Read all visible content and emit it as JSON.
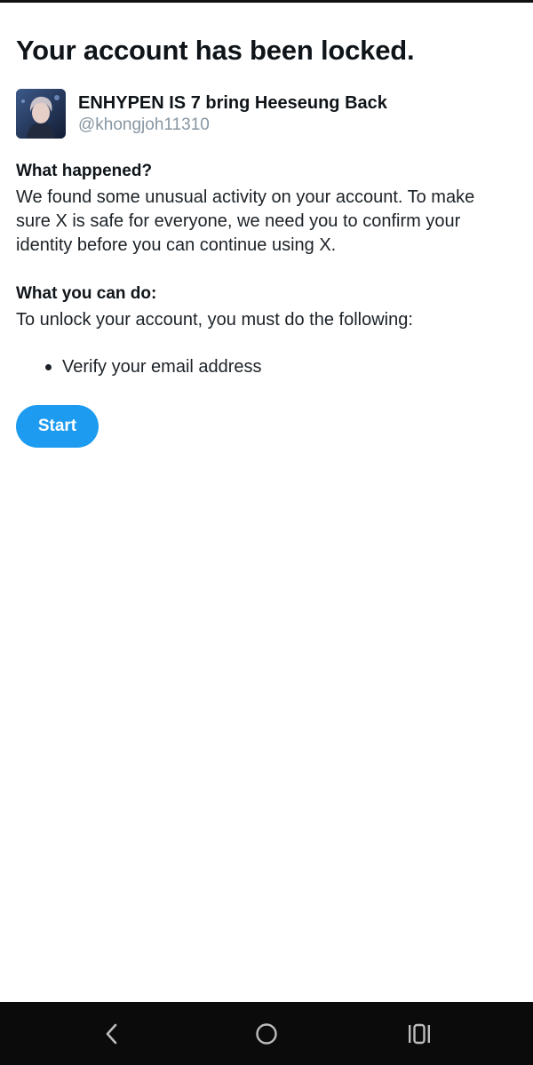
{
  "page": {
    "title": "Your account has been locked."
  },
  "profile": {
    "display_name": "ENHYPEN IS 7 bring Heeseung Back",
    "handle": "@khongjoh11310",
    "avatar_icon": "user-photo"
  },
  "what_happened": {
    "heading": "What happened?",
    "body": "We found some unusual activity on your account. To make sure X is safe for everyone, we need you to confirm your identity before you can continue using X."
  },
  "what_you_can_do": {
    "heading": "What you can do:",
    "body": "To unlock your account, you must do the following:",
    "items": [
      {
        "label": "Verify your email address"
      }
    ]
  },
  "actions": {
    "start_label": "Start"
  },
  "nav_bar": {
    "back_icon": "back-chevron-icon",
    "home_icon": "home-circle-icon",
    "recents_icon": "recent-apps-icon"
  },
  "colors": {
    "accent": "#1d9bf0",
    "text": "#0f1419",
    "secondary_text": "#8796a2",
    "nav_bar": "#0b0b0b"
  }
}
